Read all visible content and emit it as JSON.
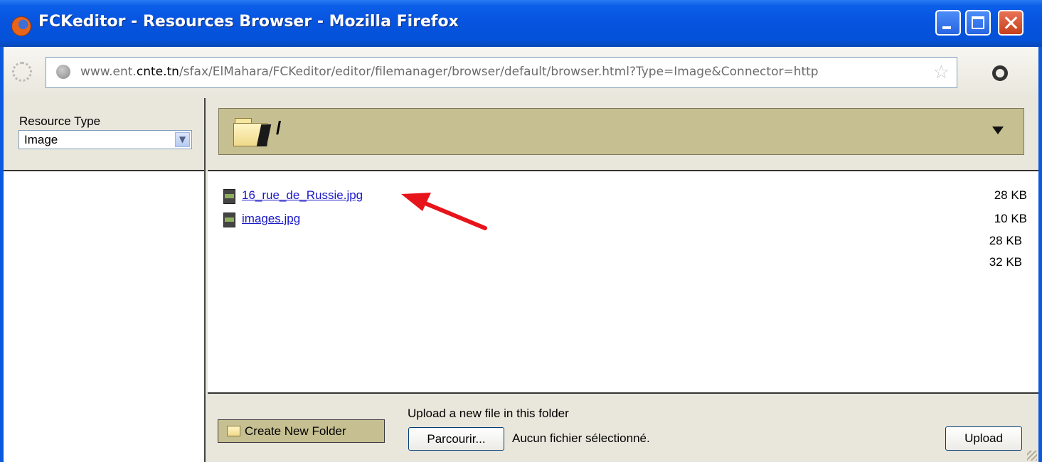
{
  "window": {
    "title": "FCKeditor - Resources Browser - Mozilla Firefox"
  },
  "navbar": {
    "url_prefix": "www.ent.",
    "url_host": "cnte.tn",
    "url_path": "/sfax/ElMahara/FCKeditor/editor/filemanager/browser/default/browser.html?Type=Image&Connector=http"
  },
  "resource_type": {
    "label": "Resource Type",
    "selected": "Image"
  },
  "folder": {
    "path": "/"
  },
  "files": [
    {
      "name": "16_rue_de_Russie.jpg",
      "size": "28 KB"
    },
    {
      "name": "images.jpg",
      "size": "10 KB"
    }
  ],
  "extra_sizes": [
    "28 KB",
    "32 KB"
  ],
  "footer": {
    "create_folder_label": "Create New Folder",
    "upload_label": "Upload a new file in this folder",
    "browse_label": "Parcourir...",
    "no_file_text": "Aucun fichier sélectionné.",
    "upload_button": "Upload"
  },
  "colors": {
    "titlebar": "#0653de",
    "panel": "#e9e7dc",
    "folderbar": "#c6bf91",
    "link": "#1a18c8",
    "annotation_arrow": "#e8141b"
  }
}
